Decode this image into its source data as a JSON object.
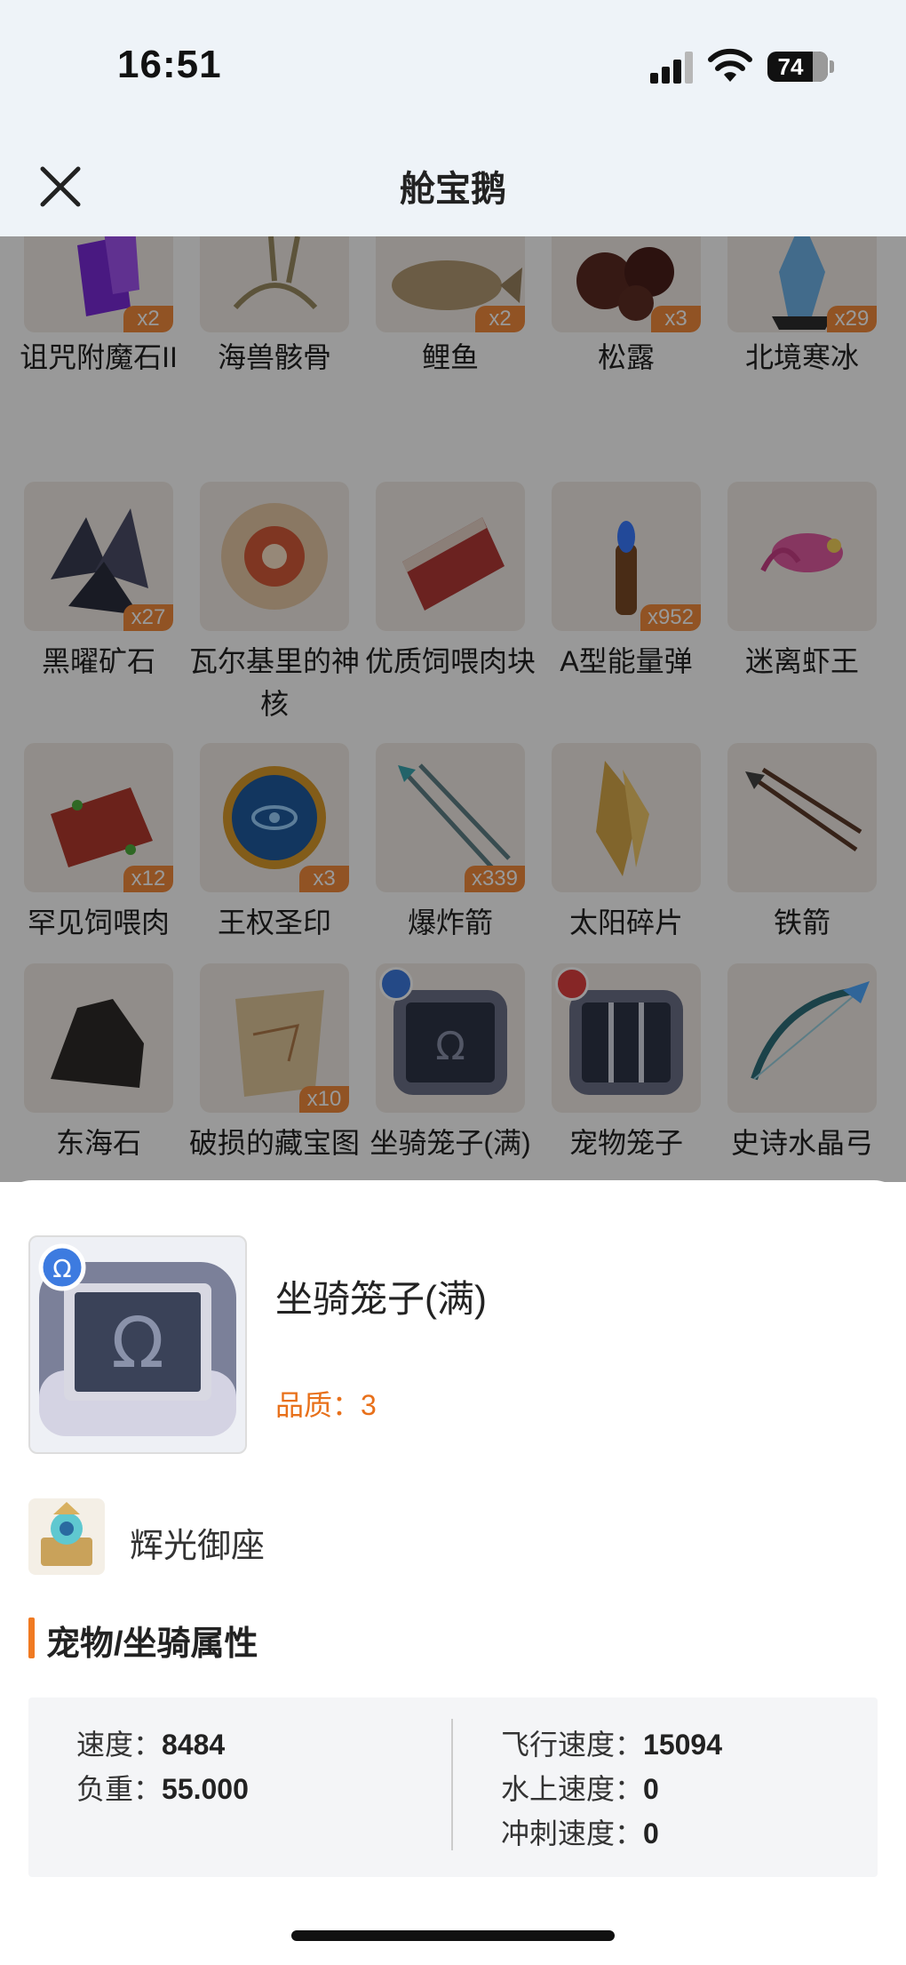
{
  "status_bar": {
    "time": "16:51",
    "battery": "74"
  },
  "header": {
    "title": "舱宝鹅",
    "close_icon": "close-icon"
  },
  "grid": {
    "items": [
      {
        "label": "诅咒附魔石II",
        "count": "x2"
      },
      {
        "label": "海兽骸骨",
        "count": ""
      },
      {
        "label": "鲤鱼",
        "count": "x2"
      },
      {
        "label": "松露",
        "count": "x3"
      },
      {
        "label": "北境寒冰",
        "count": "x29"
      },
      {
        "label": "黑曜矿石",
        "count": "x27"
      },
      {
        "label": "瓦尔基里的神核",
        "count": ""
      },
      {
        "label": "优质饲喂肉块",
        "count": ""
      },
      {
        "label": "A型能量弹",
        "count": "x952"
      },
      {
        "label": "迷离虾王",
        "count": ""
      },
      {
        "label": "罕见饲喂肉",
        "count": "x12"
      },
      {
        "label": "王权圣印",
        "count": "x3"
      },
      {
        "label": "爆炸箭",
        "count": "x339"
      },
      {
        "label": "太阳碎片",
        "count": ""
      },
      {
        "label": "铁箭",
        "count": ""
      },
      {
        "label": "东海石",
        "count": ""
      },
      {
        "label": "破损的藏宝图",
        "count": "x10"
      },
      {
        "label": "坐骑笼子(满)",
        "count": ""
      },
      {
        "label": "宠物笼子",
        "count": ""
      },
      {
        "label": "史诗水晶弓",
        "count": ""
      }
    ]
  },
  "detail": {
    "name": "坐骑笼子(满)",
    "quality": "品质：3",
    "owner": "辉光御座",
    "section_title": "宠物/坐骑属性",
    "attributes_left": [
      {
        "label": "速度：",
        "value": "8484"
      },
      {
        "label": "负重：",
        "value": "55.000"
      }
    ],
    "attributes_right": [
      {
        "label": "飞行速度：",
        "value": "15094"
      },
      {
        "label": "水上速度：",
        "value": "0"
      },
      {
        "label": "冲刺速度：",
        "value": "0"
      }
    ]
  },
  "colors": {
    "accent": "#f07a22",
    "quality": "#e8701a",
    "count_badge": "#f28a3c",
    "header_bg": "#eef3f8"
  }
}
